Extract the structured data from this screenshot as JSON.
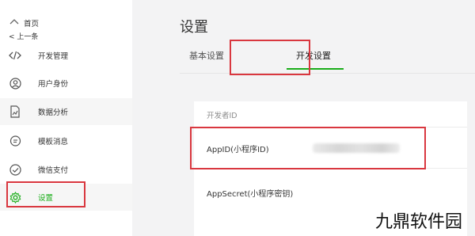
{
  "sidebar": {
    "top_partial_label": "首页",
    "back_label": "< 上一条",
    "items": [
      {
        "label": "开发管理",
        "icon": "code-icon"
      },
      {
        "label": "用户身份",
        "icon": "user-icon"
      },
      {
        "label": "数据分析",
        "icon": "document-chart-icon"
      },
      {
        "label": "模板消息",
        "icon": "chat-bubble-icon"
      },
      {
        "label": "微信支付",
        "icon": "checkmark-circle-icon"
      },
      {
        "label": "设置",
        "icon": "gear-icon"
      }
    ],
    "active_item": "设置"
  },
  "main": {
    "title": "设置",
    "tabs": [
      {
        "label": "基本设置",
        "active": false
      },
      {
        "label": "开发设置",
        "active": true
      }
    ],
    "developer_id": {
      "section_header": "开发者ID",
      "appid_label": "AppID(小程序ID)",
      "appsecret_label": "AppSecret(小程序密钥)"
    }
  },
  "watermark": "九鼎软件园",
  "colors": {
    "accent": "#1aad19",
    "highlight_box": "#d9373f",
    "background": "#f3f3f4"
  }
}
